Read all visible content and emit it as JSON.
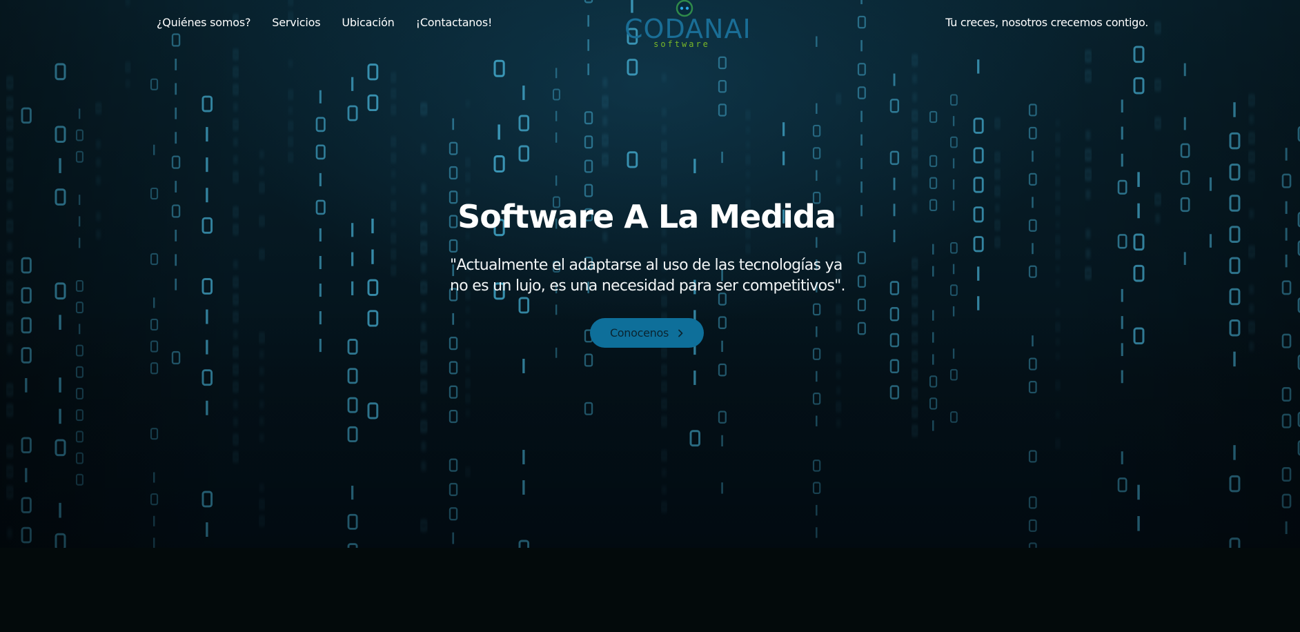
{
  "nav": {
    "items": [
      {
        "label": "¿Quiénes somos?"
      },
      {
        "label": "Servicios"
      },
      {
        "label": "Ubicación"
      },
      {
        "label": "¡Contactanos!"
      }
    ]
  },
  "header": {
    "tagline": "Tu creces, nosotros crecemos contigo."
  },
  "logo": {
    "word": "CODANAI",
    "sub": "software"
  },
  "hero": {
    "title": "Software A La Medida",
    "quote_line1": "\"Actualmente el adaptarse al uso de las tecnologías ya",
    "quote_line2": "no es un lujo, es una necesidad para ser competitivos\".",
    "cta_label": "Conocenos",
    "cta_icon": "chevron-right-icon"
  },
  "colors": {
    "accent": "#0e6f9a",
    "logo_blue": "#1a6e96",
    "logo_green": "#7ab828",
    "background": "#061a24"
  }
}
